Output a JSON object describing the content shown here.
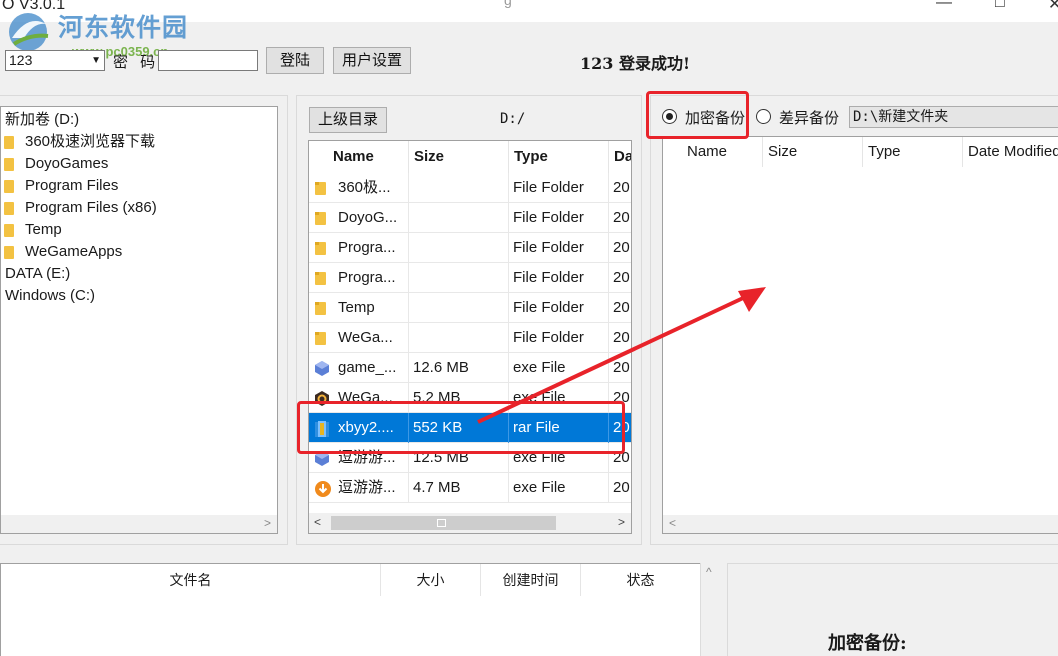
{
  "window": {
    "title": "O  V3.0.1",
    "title_mid": "g",
    "minimize_glyph": "—",
    "maximize_glyph": "□",
    "close_glyph": "✕"
  },
  "watermark": {
    "text": "河东软件园",
    "url": "www.pc0359.cn"
  },
  "login": {
    "user_value": "123",
    "password_label": "密 码",
    "password_value": "",
    "login_button": "登陆",
    "settings_button": "用户设置",
    "status": "123  登录成功!"
  },
  "tree": {
    "items": [
      {
        "label": "新加卷 (D:)",
        "folder": false,
        "indent": 0
      },
      {
        "label": "360极速浏览器下载",
        "folder": true,
        "indent": 1
      },
      {
        "label": "DoyoGames",
        "folder": true,
        "indent": 1
      },
      {
        "label": "Program Files",
        "folder": true,
        "indent": 1
      },
      {
        "label": "Program Files (x86)",
        "folder": true,
        "indent": 1
      },
      {
        "label": "Temp",
        "folder": true,
        "indent": 1
      },
      {
        "label": "WeGameApps",
        "folder": true,
        "indent": 1
      },
      {
        "label": "DATA (E:)",
        "folder": false,
        "indent": 0
      },
      {
        "label": "Windows (C:)",
        "folder": false,
        "indent": 0
      }
    ]
  },
  "browser": {
    "up_button": "上级目录",
    "path": "D:/",
    "columns": [
      "Name",
      "Size",
      "Type",
      "Da"
    ],
    "rows": [
      {
        "name": "360极...",
        "size": "",
        "type": "File Folder",
        "date": "20",
        "icon": "folder",
        "selected": false
      },
      {
        "name": "DoyoG...",
        "size": "",
        "type": "File Folder",
        "date": "20",
        "icon": "folder",
        "selected": false
      },
      {
        "name": "Progra...",
        "size": "",
        "type": "File Folder",
        "date": "20",
        "icon": "folder",
        "selected": false
      },
      {
        "name": "Progra...",
        "size": "",
        "type": "File Folder",
        "date": "20",
        "icon": "folder",
        "selected": false
      },
      {
        "name": "Temp",
        "size": "",
        "type": "File Folder",
        "date": "20",
        "icon": "folder",
        "selected": false
      },
      {
        "name": "WeGa...",
        "size": "",
        "type": "File Folder",
        "date": "20",
        "icon": "folder",
        "selected": false
      },
      {
        "name": "game_...",
        "size": "12.6 MB",
        "type": "exe File",
        "date": "20",
        "icon": "game",
        "selected": false
      },
      {
        "name": "WeGa...",
        "size": "5.2 MB",
        "type": "exe File",
        "date": "20",
        "icon": "wegame",
        "selected": false
      },
      {
        "name": "xbyy2....",
        "size": "552 KB",
        "type": "rar File",
        "date": "20",
        "icon": "rar",
        "selected": true
      },
      {
        "name": "逗游游...",
        "size": "12.5 MB",
        "type": "exe File",
        "date": "20",
        "icon": "game",
        "selected": false
      },
      {
        "name": "逗游游...",
        "size": "4.7 MB",
        "type": "exe File",
        "date": "20",
        "icon": "download",
        "selected": false
      }
    ]
  },
  "backup": {
    "encrypt_label": "加密备份",
    "encrypt_checked": true,
    "diff_label": "差异备份",
    "diff_checked": false,
    "target_dir": "D:\\新建文件夹",
    "columns": [
      "Name",
      "Size",
      "Type",
      "Date Modified"
    ]
  },
  "bottom": {
    "columns": [
      "文件名",
      "大小",
      "创建时间",
      "状态"
    ],
    "heading": "加密备份:"
  },
  "colors": {
    "selection": "#0078d7",
    "annotation_red": "#e8232a",
    "folder": "#f3c242"
  }
}
